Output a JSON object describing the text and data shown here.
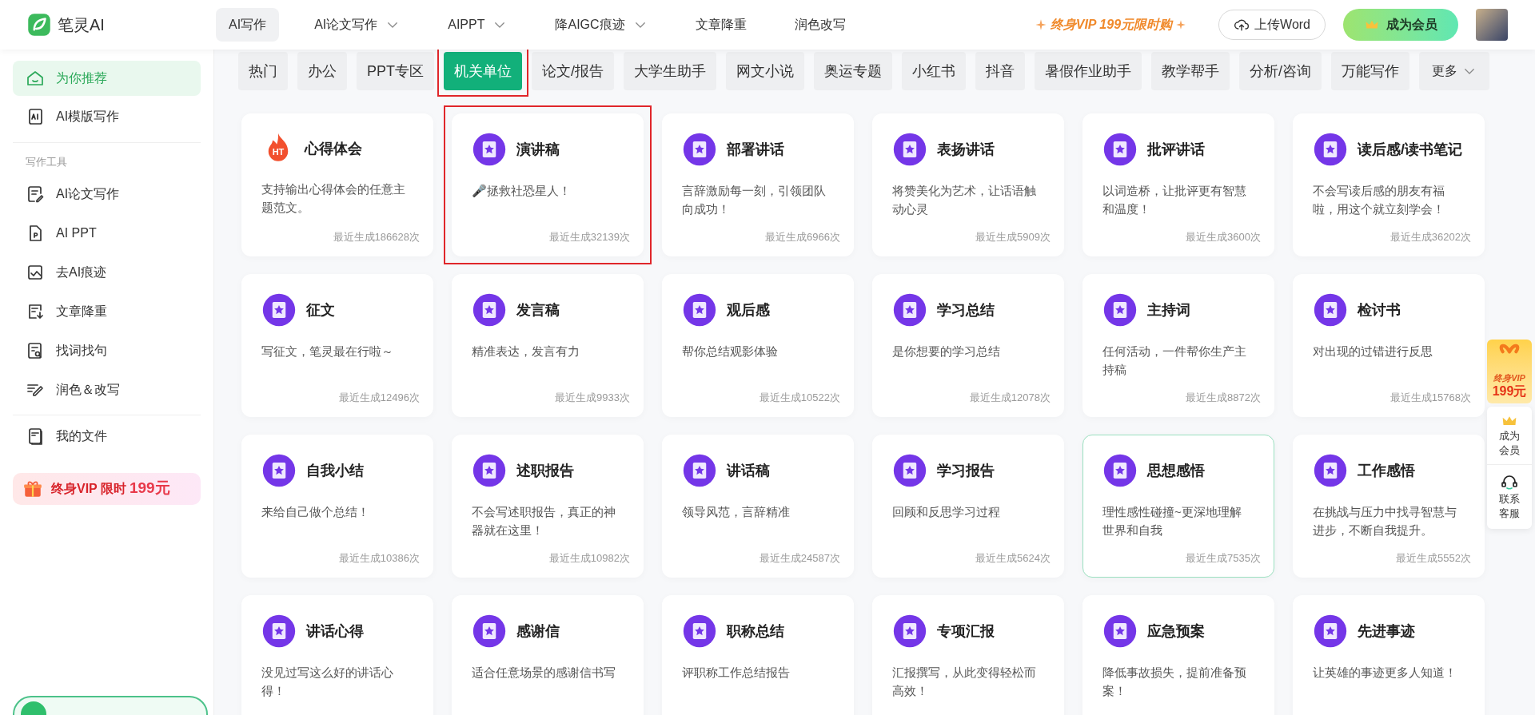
{
  "header": {
    "logo": "笔灵AI",
    "nav": [
      {
        "label": "AI写作",
        "selected": true,
        "dropdown": false
      },
      {
        "label": "AI论文写作",
        "selected": false,
        "dropdown": true
      },
      {
        "label": "AIPPT",
        "selected": false,
        "dropdown": true
      },
      {
        "label": "降AIGC痕迹",
        "selected": false,
        "dropdown": true
      },
      {
        "label": "文章降重",
        "selected": false,
        "dropdown": false
      },
      {
        "label": "润色改写",
        "selected": false,
        "dropdown": false
      }
    ],
    "promo": "终身VIP 199元限时购",
    "upload_button": "上传Word",
    "member_button": "成为会员"
  },
  "sidebar": {
    "top_items": [
      {
        "label": "为你推荐",
        "selected": true
      },
      {
        "label": "AI模版写作",
        "selected": false
      }
    ],
    "section_label": "写作工具",
    "tool_items": [
      {
        "label": "AI论文写作"
      },
      {
        "label": "AI PPT"
      },
      {
        "label": "去AI痕迹"
      },
      {
        "label": "文章降重"
      },
      {
        "label": "找词找句"
      },
      {
        "label": "润色＆改写"
      }
    ],
    "file_item": "我的文件",
    "vip_banner": {
      "text": "终身VIP 限时",
      "price": "199元"
    }
  },
  "categories": [
    {
      "label": "热门",
      "selected": false,
      "outlined": false
    },
    {
      "label": "办公",
      "selected": false,
      "outlined": false
    },
    {
      "label": "PPT专区",
      "selected": false,
      "outlined": false
    },
    {
      "label": "机关单位",
      "selected": true,
      "outlined": true
    },
    {
      "label": "论文/报告",
      "selected": false,
      "outlined": false
    },
    {
      "label": "大学生助手",
      "selected": false,
      "outlined": false
    },
    {
      "label": "网文小说",
      "selected": false,
      "outlined": false
    },
    {
      "label": "奥运专题",
      "selected": false,
      "outlined": false
    },
    {
      "label": "小红书",
      "selected": false,
      "outlined": false
    },
    {
      "label": "抖音",
      "selected": false,
      "outlined": false
    },
    {
      "label": "暑假作业助手",
      "selected": false,
      "outlined": false
    },
    {
      "label": "教学帮手",
      "selected": false,
      "outlined": false
    },
    {
      "label": "分析/咨询",
      "selected": false,
      "outlined": false
    },
    {
      "label": "万能写作",
      "selected": false,
      "outlined": false
    }
  ],
  "more_button": "更多",
  "cards": [
    {
      "kind": "fire",
      "icon_text": "HT",
      "title": "心得体会",
      "description": "支持输出心得体会的任意主题范文。",
      "count": "最近生成186628次",
      "outlined": false,
      "hovered": false
    },
    {
      "kind": "star",
      "title": "演讲稿",
      "description": "🎤拯救社恐星人！",
      "count": "最近生成32139次",
      "outlined": true,
      "hovered": false
    },
    {
      "kind": "star",
      "title": "部署讲话",
      "description": "言辞激励每一刻，引领团队向成功！",
      "count": "最近生成6966次",
      "outlined": false,
      "hovered": false
    },
    {
      "kind": "star",
      "title": "表扬讲话",
      "description": "将赞美化为艺术，让话语触动心灵",
      "count": "最近生成5909次",
      "outlined": false,
      "hovered": false
    },
    {
      "kind": "star",
      "title": "批评讲话",
      "description": "以词造桥，让批评更有智慧和温度！",
      "count": "最近生成3600次",
      "outlined": false,
      "hovered": false
    },
    {
      "kind": "star",
      "title": "读后感/读书笔记",
      "description": "不会写读后感的朋友有福啦，用这个就立刻学会！",
      "count": "最近生成36202次",
      "outlined": false,
      "hovered": false
    },
    {
      "kind": "star",
      "title": "征文",
      "description": "写征文，笔灵最在行啦～",
      "count": "最近生成12496次",
      "outlined": false,
      "hovered": false
    },
    {
      "kind": "star",
      "title": "发言稿",
      "description": "精准表达，发言有力",
      "count": "最近生成9933次",
      "outlined": false,
      "hovered": false
    },
    {
      "kind": "star",
      "title": "观后感",
      "description": "帮你总结观影体验",
      "count": "最近生成10522次",
      "outlined": false,
      "hovered": false
    },
    {
      "kind": "star",
      "title": "学习总结",
      "description": "是你想要的学习总结",
      "count": "最近生成12078次",
      "outlined": false,
      "hovered": false
    },
    {
      "kind": "star",
      "title": "主持词",
      "description": "任何活动，一件帮你生产主持稿",
      "count": "最近生成8872次",
      "outlined": false,
      "hovered": false
    },
    {
      "kind": "star",
      "title": "检讨书",
      "description": "对出现的过错进行反思",
      "count": "最近生成15768次",
      "outlined": false,
      "hovered": false
    },
    {
      "kind": "star",
      "title": "自我小结",
      "description": "来给自己做个总结！",
      "count": "最近生成10386次",
      "outlined": false,
      "hovered": false
    },
    {
      "kind": "star",
      "title": "述职报告",
      "description": "不会写述职报告，真正的神器就在这里！",
      "count": "最近生成10982次",
      "outlined": false,
      "hovered": false
    },
    {
      "kind": "star",
      "title": "讲话稿",
      "description": "领导风范，言辞精准",
      "count": "最近生成24587次",
      "outlined": false,
      "hovered": false
    },
    {
      "kind": "star",
      "title": "学习报告",
      "description": "回顾和反思学习过程",
      "count": "最近生成5624次",
      "outlined": false,
      "hovered": false
    },
    {
      "kind": "star",
      "title": "思想感悟",
      "description": "理性感性碰撞~更深地理解世界和自我",
      "count": "最近生成7535次",
      "outlined": false,
      "hovered": true
    },
    {
      "kind": "star",
      "title": "工作感悟",
      "description": "在挑战与压力中找寻智慧与进步，不断自我提升。",
      "count": "最近生成5552次",
      "outlined": false,
      "hovered": false
    },
    {
      "kind": "star",
      "title": "讲话心得",
      "description": "没见过写这么好的讲话心得！",
      "outlined": false,
      "hovered": false
    },
    {
      "kind": "star",
      "title": "感谢信",
      "description": "适合任意场景的感谢信书写",
      "outlined": false,
      "hovered": false
    },
    {
      "kind": "star",
      "title": "职称总结",
      "description": "评职称工作总结报告",
      "outlined": false,
      "hovered": false
    },
    {
      "kind": "star",
      "title": "专项汇报",
      "description": "汇报撰写，从此变得轻松而高效！",
      "outlined": false,
      "hovered": false
    },
    {
      "kind": "star",
      "title": "应急预案",
      "description": "降低事故损失，提前准备预案！",
      "outlined": false,
      "hovered": false
    },
    {
      "kind": "star",
      "title": "先进事迹",
      "description": "让英雄的事迹更多人知道！",
      "outlined": false,
      "hovered": false
    }
  ],
  "float_panel": {
    "gift_text": "终身VIP",
    "gift_price": "199元",
    "member": "成为会员",
    "service": "联系客服"
  }
}
